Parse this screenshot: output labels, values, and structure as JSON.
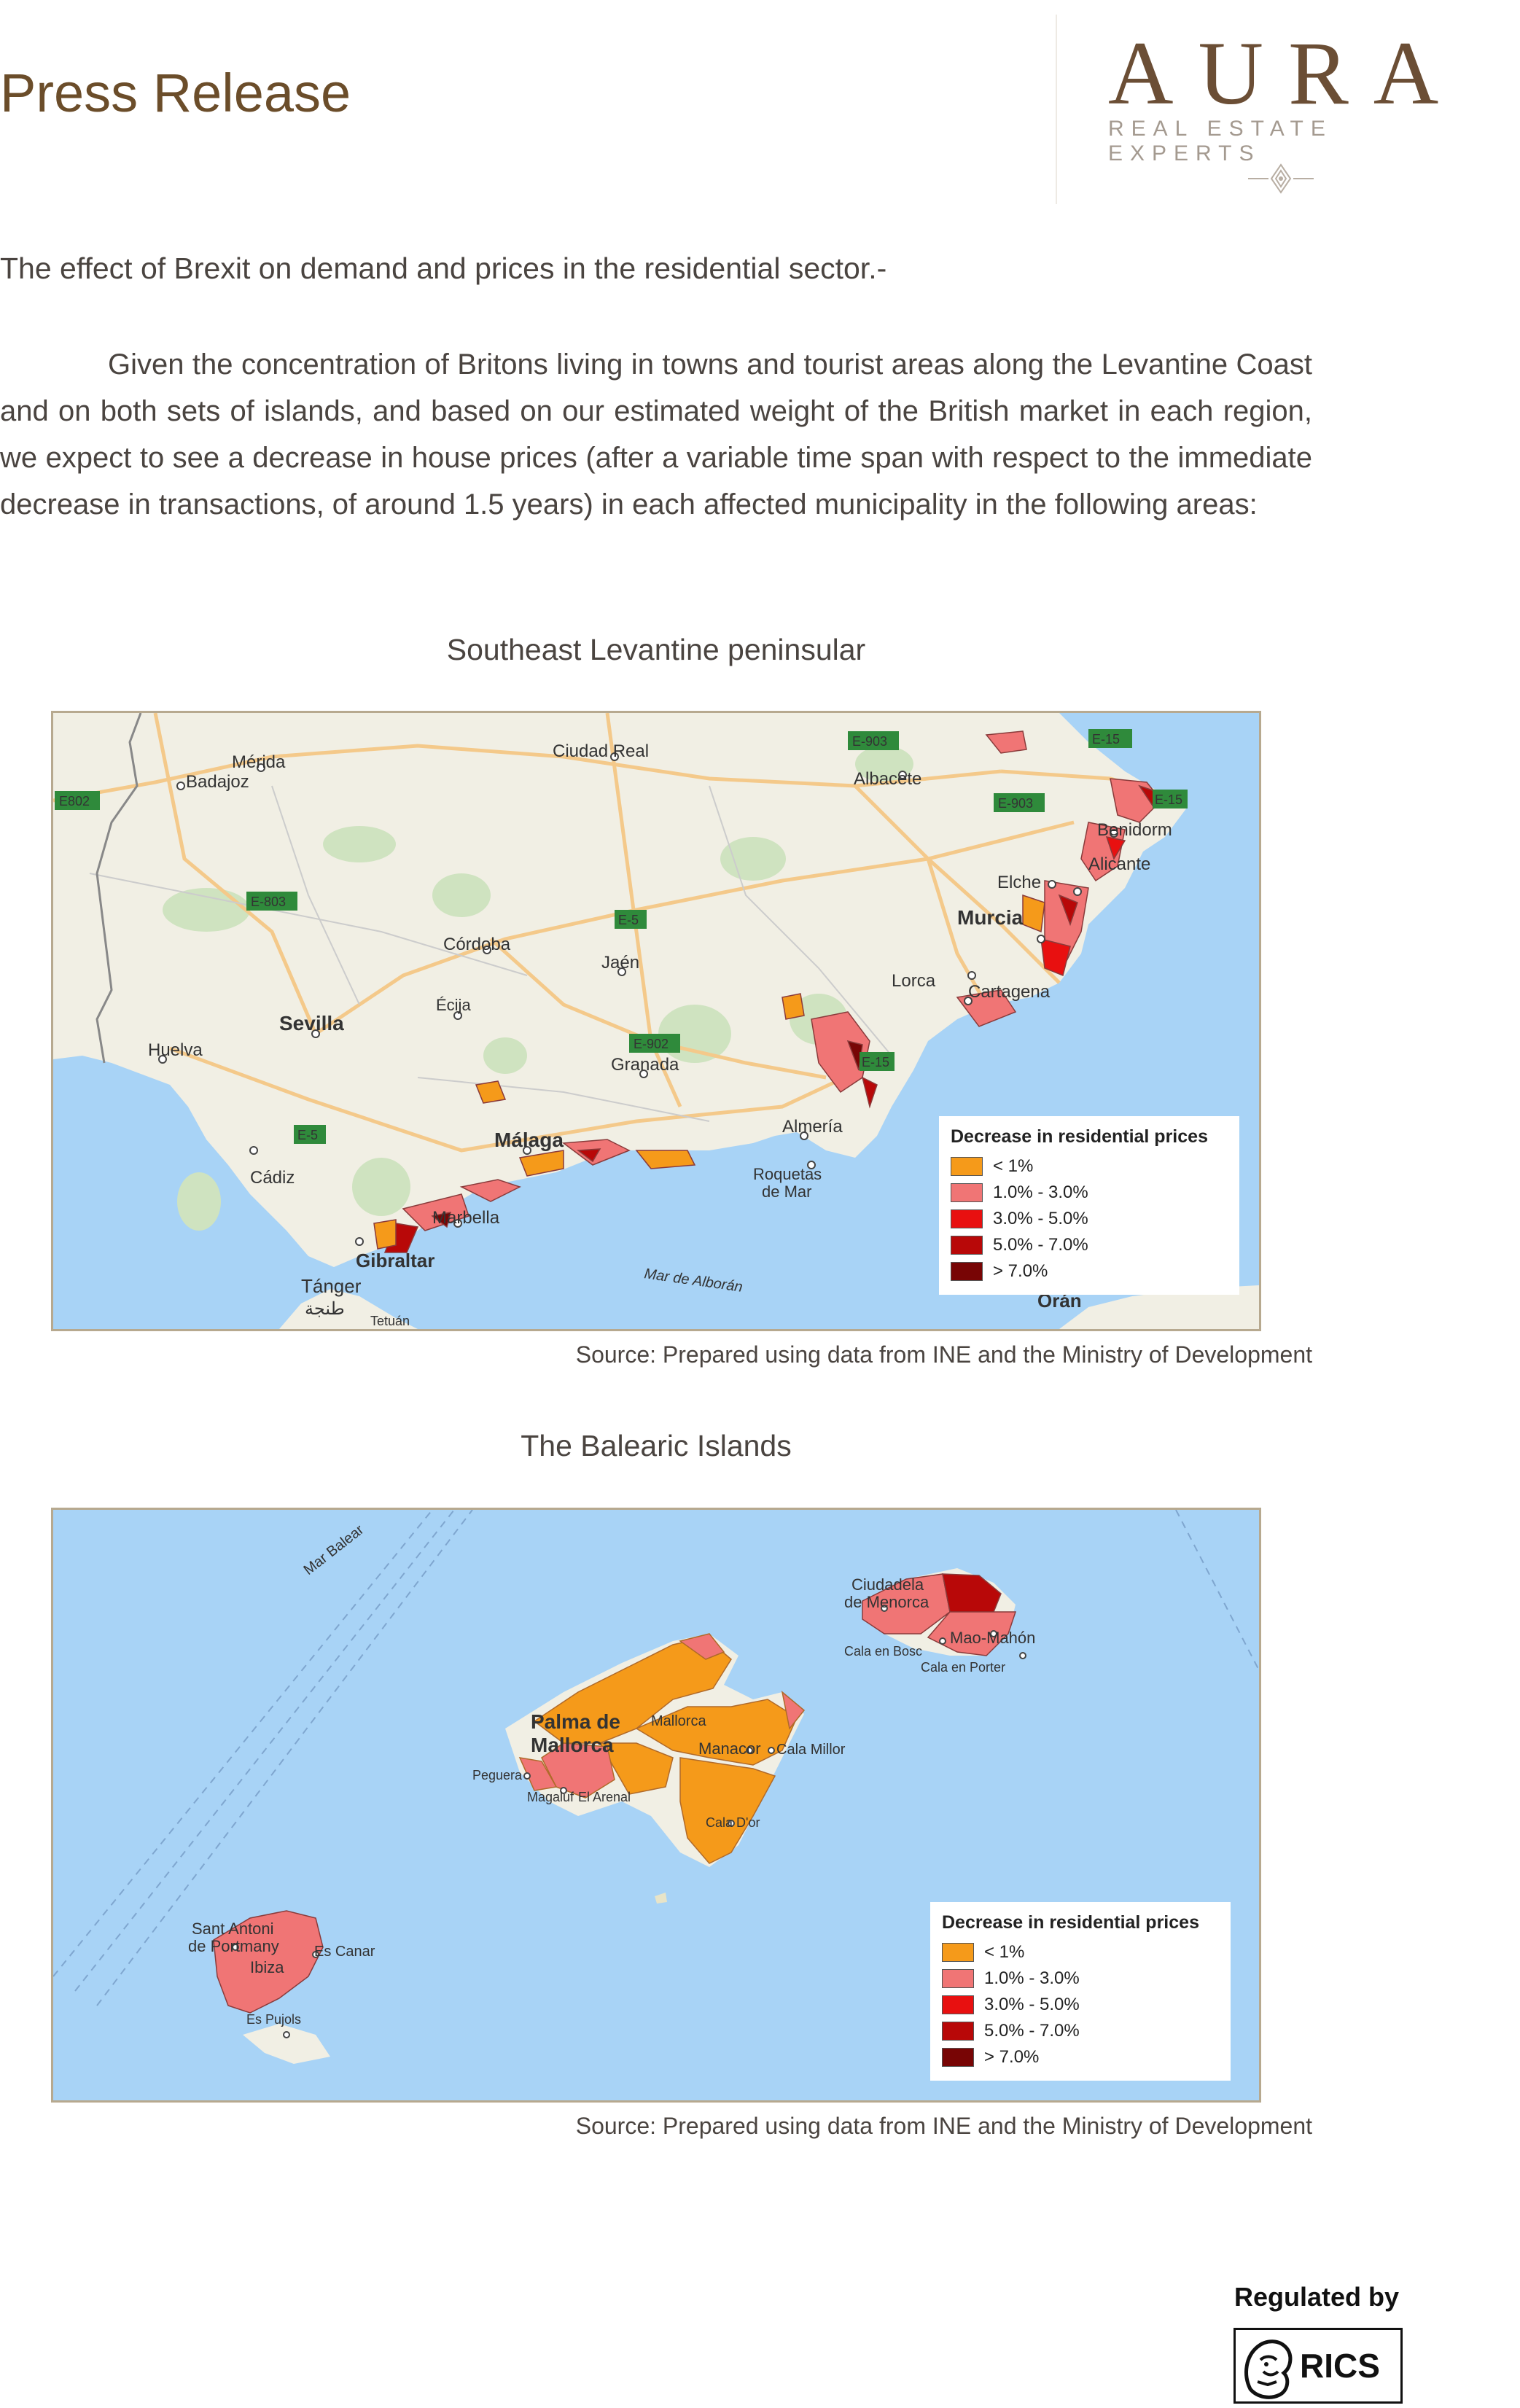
{
  "header": {
    "title": "Press Release",
    "logo_word": "AURA",
    "logo_sub": "REAL ESTATE EXPERTS"
  },
  "article": {
    "heading": "The effect of Brexit on demand and prices in the residential sector.-",
    "paragraph": "Given the concentration of Britons living in towns and tourist areas along the Levantine Coast and on both sets of islands, and based on our estimated weight of the British market in each region, we expect to see a decrease in house prices (after a variable time span with respect to the immediate decrease in transactions, of around 1.5 years) in each affected municipality in the following areas:"
  },
  "maps": [
    {
      "caption": "Southeast Levantine peninsular",
      "source": "Source: Prepared using data from INE and the Ministry of Development",
      "legend": {
        "title": "Decrease in residential prices",
        "items": [
          {
            "label": "< 1%",
            "color": "#f59a1a"
          },
          {
            "label": "1.0% - 3.0%",
            "color": "#f07575"
          },
          {
            "label": "3.0% - 5.0%",
            "color": "#e81010"
          },
          {
            "label": "5.0% - 7.0%",
            "color": "#b80808"
          },
          {
            "label": "> 7.0%",
            "color": "#780505"
          }
        ]
      },
      "places": {
        "merida": "Mérida",
        "badajoz": "Badajoz",
        "ciudad_real": "Ciudad Real",
        "albacete": "Albacete",
        "benidorm": "Benidorm",
        "alicante": "Alicante",
        "elche": "Elche",
        "murcia": "Murcia",
        "cordoba": "Córdoba",
        "jaen": "Jaén",
        "ecija": "Écija",
        "sevilla": "Sevilla",
        "huelva": "Huelva",
        "lorca": "Lorca",
        "cartagena": "Cartagena",
        "granada": "Granada",
        "malaga": "Málaga",
        "almeria": "Almería",
        "roquetas": "Roquetas",
        "de_mar": "de Mar",
        "cadiz": "Cádiz",
        "marbella": "Marbella",
        "gibraltar": "Gibraltar",
        "tanger": "Tánger",
        "tanger_ar": "طنجة",
        "tetuan": "Tetuán",
        "oran": "Orán",
        "alboran": "Mar de Alborán"
      },
      "roads": {
        "e803": "E-803",
        "e802": "E802",
        "e903a": "E-903",
        "e903b": "E-903",
        "e15a": "E-15",
        "e15b": "E-15",
        "e15c": "E-15",
        "e5a": "E-5",
        "e5b": "E-5",
        "e902": "E-902"
      }
    },
    {
      "caption": "The Balearic Islands",
      "source": "Source: Prepared using data from INE and the Ministry of Development",
      "legend": {
        "title": "Decrease in residential prices",
        "items": [
          {
            "label": "< 1%",
            "color": "#f59a1a"
          },
          {
            "label": "1.0% - 3.0%",
            "color": "#f07575"
          },
          {
            "label": "3.0% - 5.0%",
            "color": "#e81010"
          },
          {
            "label": "5.0% - 7.0%",
            "color": "#b80808"
          },
          {
            "label": "> 7.0%",
            "color": "#780505"
          }
        ]
      },
      "places": {
        "mar_balear": "Mar Balear",
        "ciudadela": "Ciudadela",
        "de_menorca": "de Menorca",
        "mao": "Mao-Mahón",
        "cala_bosc": "Cala en Bosc",
        "cala_porter": "Cala en Porter",
        "palma1": "Palma de",
        "palma2": "Mallorca",
        "mallorca": "Mallorca",
        "manacor": "Manacor",
        "cala_millor": "Cala Millor",
        "peguera": "Peguera",
        "magaluf": "Magaluf",
        "arenal": "El Arenal",
        "cala_dor": "Cala D'or",
        "sant_antoni1": "Sant Antoni",
        "sant_antoni2": "de Portmany",
        "ibiza": "Ibiza",
        "es_canar": "Es Canar",
        "es_pujols": "Es Pujols"
      }
    }
  ],
  "footer": {
    "regulated": "Regulated by",
    "rics": "RICS"
  }
}
